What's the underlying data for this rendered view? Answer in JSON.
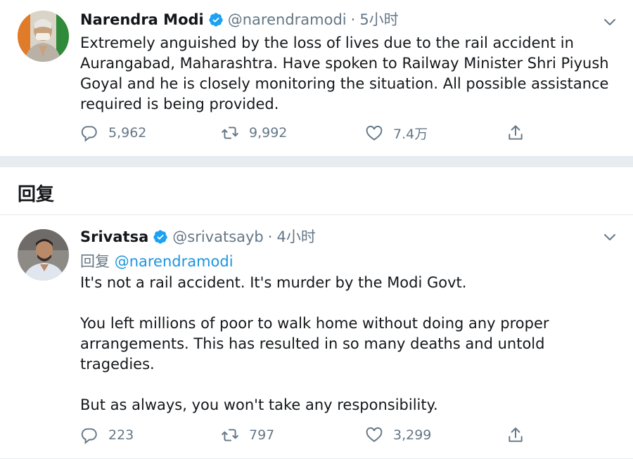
{
  "tweet1": {
    "name": "Narendra Modi",
    "handle": "@narendramodi",
    "separator": "·",
    "time": "5小时",
    "body": "Extremely anguished by the loss of lives due to the rail accident in Aurangabad, Maharashtra. Have spoken to Railway Minister Shri Piyush Goyal and he is closely monitoring the situation. All possible assistance required is being provided.",
    "replies": "5,962",
    "retweets": "9,992",
    "likes": "7.4万"
  },
  "replies_header": "回复",
  "tweet2": {
    "name": "Srivatsa",
    "handle": "@srivatsayb",
    "separator": "·",
    "time": "4小时",
    "reply_prefix": "回复",
    "reply_mention": "@narendramodi",
    "paragraphs": [
      "It's not a rail accident. It's murder by the Modi Govt.",
      "You left millions of poor to walk home without doing any proper arrangements. This has resulted in so many deaths and untold tragedies.",
      "But as always, you won't take any responsibility."
    ],
    "replies": "223",
    "retweets": "797",
    "likes": "3,299"
  },
  "colors": {
    "accent": "#1da1f2",
    "mention": "#1b95e0",
    "muted": "#657786",
    "divider": "#e6ecf0"
  },
  "icons": [
    "verified-badge-icon",
    "chevron-down-icon",
    "reply-icon",
    "retweet-icon",
    "like-icon",
    "share-icon"
  ]
}
